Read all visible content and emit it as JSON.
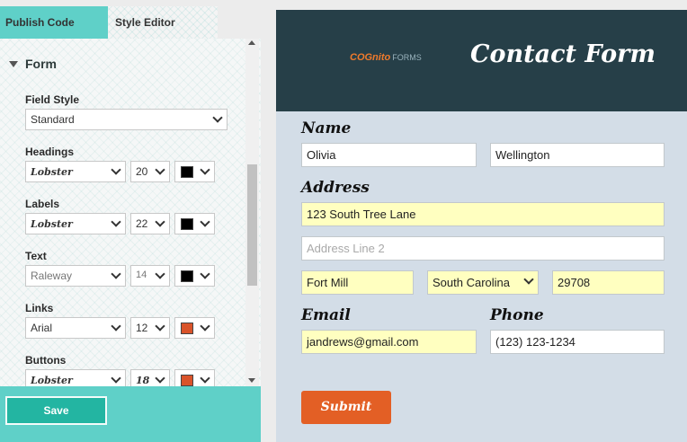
{
  "tabs": {
    "publish": "Publish Code",
    "style_editor": "Style Editor"
  },
  "editor": {
    "section": "Form",
    "field_style": {
      "label": "Field Style",
      "value": "Standard"
    },
    "headings": {
      "label": "Headings",
      "font": "Lobster",
      "size": "20",
      "color": "#000000"
    },
    "labels": {
      "label": "Labels",
      "font": "Lobster",
      "size": "22",
      "color": "#000000"
    },
    "text": {
      "label": "Text",
      "font": "Raleway",
      "size": "14",
      "color": "#000000"
    },
    "links": {
      "label": "Links",
      "font": "Arial",
      "size": "12",
      "color": "#d9532a"
    },
    "buttons": {
      "label": "Buttons",
      "font": "Lobster",
      "size": "18",
      "color": "#d9532a"
    },
    "save_label": "Save"
  },
  "preview": {
    "logo_text": "COGnito",
    "logo_suffix": "FORMS",
    "title": "Contact Form",
    "name_label": "Name",
    "first_name": "Olivia",
    "last_name": "Wellington",
    "address_label": "Address",
    "address_line1": "123 South Tree Lane",
    "address_line2_placeholder": "Address Line 2",
    "city": "Fort Mill",
    "state": "South Carolina",
    "zip": "29708",
    "email_label": "Email",
    "email": "jandrews@gmail.com",
    "phone_label": "Phone",
    "phone": "(123) 123-1234",
    "submit_label": "Submit"
  },
  "colors": {
    "accent": "#5fd0c8",
    "header": "#263f48",
    "required_field": "#ffffc0",
    "submit": "#e35f25"
  }
}
